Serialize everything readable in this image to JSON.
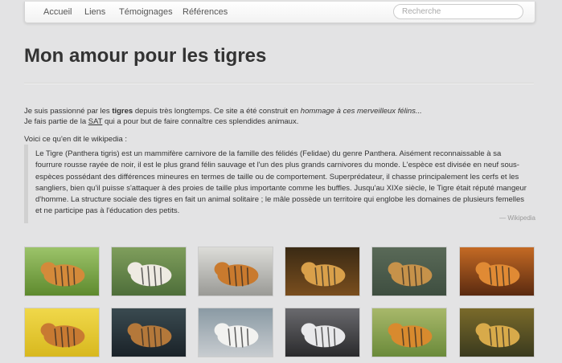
{
  "nav": {
    "items": [
      "Accueil",
      "Liens",
      "Témoignages",
      "Références"
    ],
    "search_placeholder": "Recherche"
  },
  "page_title": "Mon amour pour les tigres",
  "intro": {
    "line1_a": "Je suis passionné par les ",
    "line1_bold": "tigres",
    "line1_b": " depuis très longtemps. Ce site a été construit en ",
    "line1_italic": "hommage à ces merveilleux félins...",
    "line2_a": "Je fais partie de la ",
    "line2_link": "SAT",
    "line2_b": " qui a pour but de faire connaître ces splendides animaux.",
    "voici": "Voici ce qu'en dit le wikipedia :"
  },
  "quote": {
    "text": "Le Tigre (Panthera tigris) est un mammifère carnivore de la famille des félidés (Felidae) du genre Panthera. Aisément reconnaissable à sa fourrure rousse rayée de noir, il est le plus grand félin sauvage et l'un des plus grands carnivores du monde. L'espèce est divisée en neuf sous-espèces possédant des différences mineures en termes de taille ou de comportement. Superprédateur, il chasse principalement les cerfs et les sangliers, bien qu'il puisse s'attaquer à des proies de taille plus importante comme les buffles. Jusqu'au XIXe siècle, le Tigre était réputé mangeur d'homme. La structure sociale des tigres en fait un animal solitaire ; le mâle possède un territoire qui englobe les domaines de plusieurs femelles et ne participe pas à l'éducation des petits.",
    "source": "— Wikipedia"
  },
  "gallery": [
    {
      "name": "tiger-lying-grass",
      "bg": "#5e8a2e",
      "top": "#9cc36a",
      "animal": "#d48a3a"
    },
    {
      "name": "white-tiger-walking",
      "bg": "#4e6e3a",
      "top": "#7f9e5c",
      "animal": "#eeeae2"
    },
    {
      "name": "tiger-snow-running",
      "bg": "#9a9a96",
      "top": "#dcdcd8",
      "animal": "#c97a2e"
    },
    {
      "name": "tiger-standing-field",
      "bg": "#7a4e1e",
      "top": "#3a2a14",
      "animal": "#d9a04a"
    },
    {
      "name": "tiger-rocks",
      "bg": "#3e4e40",
      "top": "#5a6a58",
      "animal": "#c6924a"
    },
    {
      "name": "tiger-face-closeup",
      "bg": "#5a2a10",
      "top": "#c46a24",
      "animal": "#e08a34"
    },
    {
      "name": "tiger-cub-flowers",
      "bg": "#d8b81e",
      "top": "#f0d84a",
      "animal": "#c87a32"
    },
    {
      "name": "tiger-night-forest",
      "bg": "#1a2228",
      "top": "#3a4a50",
      "animal": "#b4783a"
    },
    {
      "name": "white-tiger-snow",
      "bg": "#c8ccd0",
      "top": "#8a9aa4",
      "animal": "#f2f2f0"
    },
    {
      "name": "white-tiger-face",
      "bg": "#2a2a2c",
      "top": "#6a6a6e",
      "animal": "#e8e8ea"
    },
    {
      "name": "tiger-roaring",
      "bg": "#6a8a3a",
      "top": "#a8b86a",
      "animal": "#d88a2e"
    },
    {
      "name": "leopard-face",
      "bg": "#3a3a1e",
      "top": "#7a6a2a",
      "animal": "#d8aa4a"
    }
  ]
}
